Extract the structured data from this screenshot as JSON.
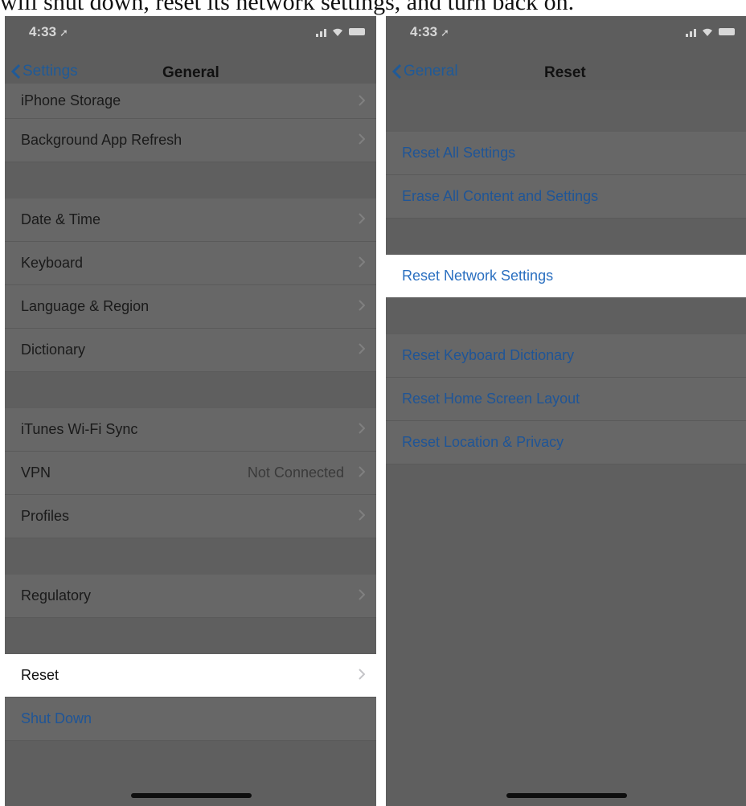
{
  "caption": "will shut down, reset its network settings, and turn back on.",
  "left": {
    "status_time": "4:33",
    "back_label": "Settings",
    "title": "General",
    "rows": {
      "iphone_storage": "iPhone Storage",
      "background_refresh": "Background App Refresh",
      "date_time": "Date & Time",
      "keyboard": "Keyboard",
      "language_region": "Language & Region",
      "dictionary": "Dictionary",
      "itunes_sync": "iTunes Wi-Fi Sync",
      "vpn": "VPN",
      "vpn_value": "Not Connected",
      "profiles": "Profiles",
      "regulatory": "Regulatory",
      "reset": "Reset",
      "shut_down": "Shut Down"
    }
  },
  "right": {
    "status_time": "4:33",
    "back_label": "General",
    "title": "Reset",
    "rows": {
      "reset_all": "Reset All Settings",
      "erase_all": "Erase All Content and Settings",
      "reset_network": "Reset Network Settings",
      "reset_keyboard": "Reset Keyboard Dictionary",
      "reset_home": "Reset Home Screen Layout",
      "reset_location": "Reset Location & Privacy"
    }
  },
  "colors": {
    "accent": "#1f5597",
    "dim_background": "#5f5f5f",
    "highlight_row": "#ffffff"
  },
  "icons": [
    "location-arrow-icon",
    "signal-icon",
    "wifi-icon",
    "battery-icon",
    "chevron-left-icon",
    "chevron-right-icon"
  ]
}
